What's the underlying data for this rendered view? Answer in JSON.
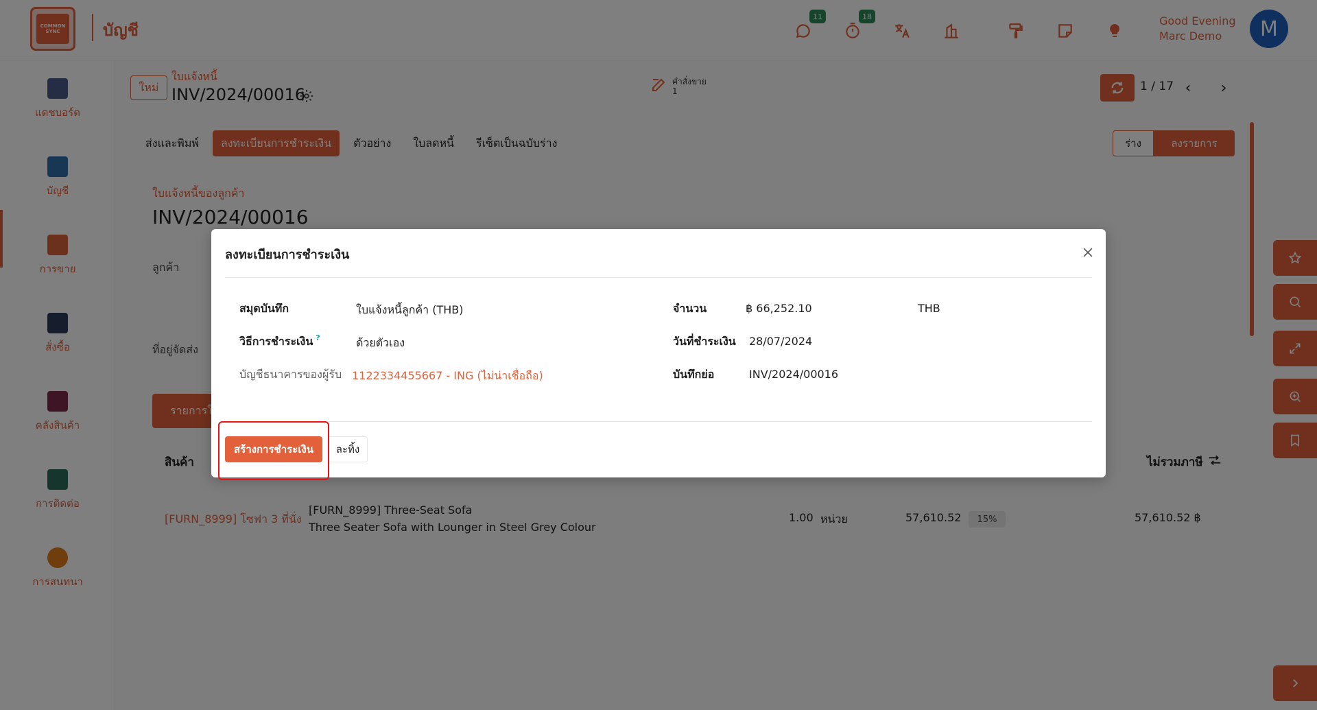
{
  "header": {
    "logo_text": "COMMON SYNC",
    "app_title": "บัญชี",
    "badges": {
      "messages": "11",
      "activities": "18"
    },
    "greeting_line1": "Good Evening",
    "greeting_line2": "Marc Demo",
    "avatar_letter": "M"
  },
  "sidebar": {
    "items": [
      {
        "label": "แดชบอร์ด",
        "color": "#4a5a8a"
      },
      {
        "label": "บัญชี",
        "color": "#2f6fa8"
      },
      {
        "label": "การขาย",
        "color": "#d9633b"
      },
      {
        "label": "สั่งซื้อ",
        "color": "#2c3a5a"
      },
      {
        "label": "คลังสินค้า",
        "color": "#7a2b4a"
      },
      {
        "label": "การติดต่อ",
        "color": "#2a6a5a"
      },
      {
        "label": "การสนทนา",
        "color": "#e07a1a"
      }
    ]
  },
  "record": {
    "new_label": "ใหม่",
    "breadcrumb_sub": "ใบแจ้งหนี้",
    "breadcrumb_title": "INV/2024/00016",
    "smart_button_label": "คำสั่งขาย",
    "smart_button_count": "1",
    "pager": "1 / 17"
  },
  "actions": [
    "ส่งและพิมพ์",
    "ลงทะเบียนการชำระเงิน",
    "ตัวอย่าง",
    "ใบลดหนี้",
    "รีเซ็ตเป็นฉบับร่าง"
  ],
  "status": {
    "draft": "ร่าง",
    "posted": "ลงรายการ"
  },
  "form": {
    "subtitle": "ใบแจ้งหนี้ของลูกค้า",
    "title": "INV/2024/00016",
    "customer_label": "ลูกค้า",
    "delivery_label": "ที่อยู่จัดส่ง",
    "lines_tab": "รายการใ",
    "col_product": "สินค้า",
    "col_subtotal": "ไม่รวมภาษี",
    "line": {
      "product": "[FURN_8999] โซฟา 3 ที่นั่ง",
      "desc1": "[FURN_8999] Three-Seat Sofa",
      "desc2": "Three Seater Sofa with Lounger in Steel Grey Colour",
      "qty": "1.00",
      "uom": "หน่วย",
      "price": "57,610.52",
      "tax": "15%",
      "subtotal": "57,610.52 ฿"
    }
  },
  "modal": {
    "title": "ลงทะเบียนการชำระเงิน",
    "journal_label": "สมุดบันทึก",
    "journal_value": "ใบแจ้งหนี้ลูกค้า (THB)",
    "method_label": "วิธีการชำระเงิน",
    "method_help": "?",
    "method_value": "ด้วยตัวเอง",
    "bank_label": "บัญชีธนาคารของผู้รับ",
    "bank_value": "1122334455667 - ING (ไม่น่าเชื่อถือ)",
    "amount_label": "จำนวน",
    "amount_value": "฿ 66,252.10",
    "currency": "THB",
    "date_label": "วันที่ชำระเงิน",
    "date_value": "28/07/2024",
    "memo_label": "บันทึกย่อ",
    "memo_value": "INV/2024/00016",
    "create_button": "สร้างการชำระเงิน",
    "discard_button": "ละทิ้ง"
  },
  "colors": {
    "accent": "#e2613b",
    "badge": "#2e8b57",
    "avatar": "#1f5fbf",
    "highlight": "#ee1111"
  }
}
